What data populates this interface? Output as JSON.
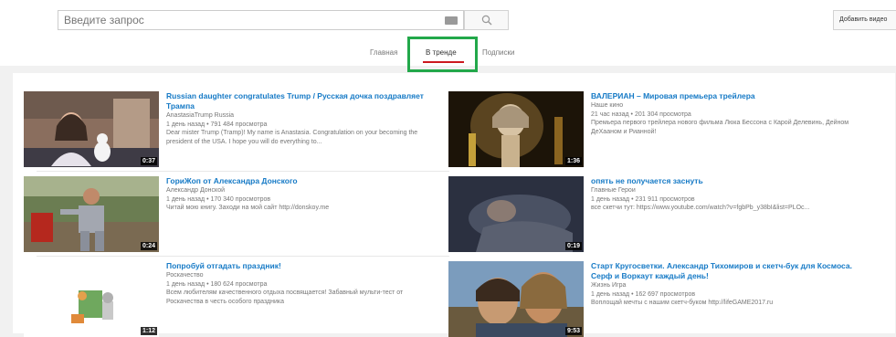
{
  "search": {
    "placeholder": "Введите запрос"
  },
  "header": {
    "upload_label": "Добавить видео"
  },
  "tabs": {
    "home": "Главная",
    "trending": "В тренде",
    "subscriptions": "Подписки"
  },
  "videos": [
    {
      "title": "Russian daughter congratulates Trump / Русская дочка поздравляет Трампа",
      "channel": "AnastasiaTrump Russia",
      "time_ago": "1 день назад",
      "views": "791 484 просмотра",
      "description": "Dear mister Trump (Tramp)! My name is Anastasia. Congratulation on your becoming the president of the USA. I hope you will do everything to...",
      "duration": "0:37"
    },
    {
      "title": "ВАЛЕРИАН – Мировая премьера трейлера",
      "channel": "Наше кино",
      "time_ago": "21 час назад",
      "views": "201 304 просмотра",
      "description": "Премьера первого трейлера нового фильма Люка Бессона с Карой Делевинь, Дейном ДеХааном и Рианной!",
      "duration": "1:36"
    },
    {
      "title": "ГориЖоп от Александра Донского",
      "channel": "Александр Донской",
      "time_ago": "1 день назад",
      "views": "170 340 просмотров",
      "description": "Читай мою книгу. Заходи на мой сайт http://donskoy.me",
      "duration": "0:24"
    },
    {
      "title": "опять не получается заснуть",
      "channel": "Главные Герои",
      "time_ago": "1 день назад",
      "views": "231 911 просмотров",
      "description": "все скетчи тут: https://www.youtube.com/watch?v=fgbPb_y38bI&list=PLOc...",
      "duration": "0:19"
    },
    {
      "title": "Попробуй отгадать праздник!",
      "channel": "Роскачество",
      "time_ago": "1 день назад",
      "views": "180 624 просмотра",
      "description": "Всем любителям качественного отдыха посвящается! Забавный мульти-тест от Роскачества в честь особого праздника",
      "duration": "1:12"
    },
    {
      "title": "Старт Кругосветки. Александр Тихомиров и скетч-бук для Космоса. Серф и Воркаут каждый день!",
      "channel": "Жизнь Игра",
      "time_ago": "1 день назад",
      "views": "162 697 просмотров",
      "description": "Воплощай мечты с нашим скетч-буком http://lifeGAME2017.ru",
      "duration": "9:53"
    }
  ],
  "colors": {
    "link": "#167ac6",
    "meta": "#767676",
    "tab_underline": "#cc181e",
    "highlight_box": "#22a84a"
  }
}
